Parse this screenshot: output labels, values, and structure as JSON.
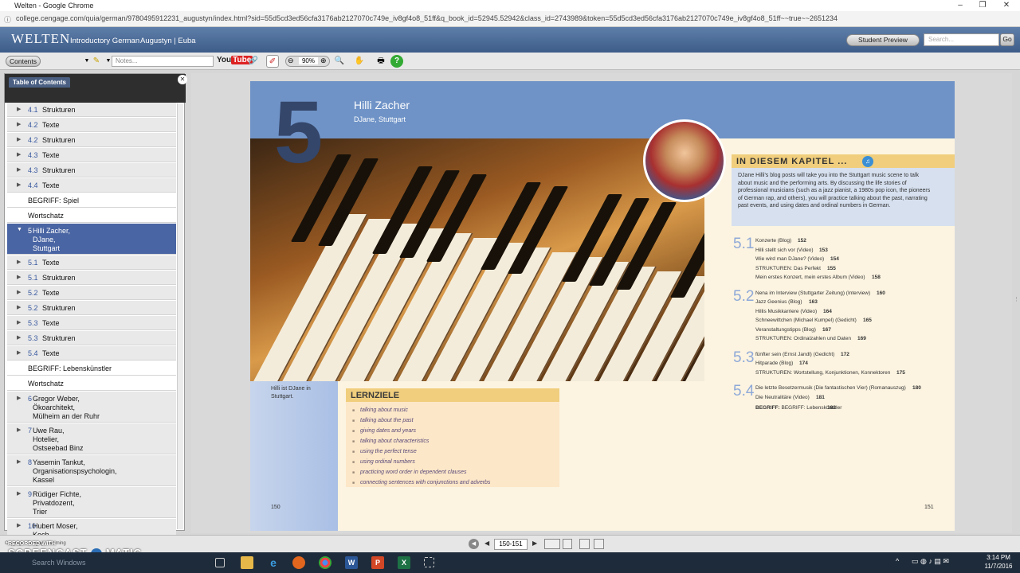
{
  "window": {
    "title": "Welten - Google Chrome"
  },
  "url": "college.cengage.com/quia/german/9780495912231_augustyn/index.html?sid=55d5cd3ed56cfa3176ab2127070c749e_iv8gf4o8_51ff&q_book_id=52945.52942&class_id=2743989&token=55d5cd3ed56cfa3176ab2127070c749e_iv8gf4o8_51ff~~true~~2651234",
  "header": {
    "logo": "WELTEN",
    "nav1": "Introductory German",
    "nav2": "Augustyn | Euba",
    "student_preview": "Student Preview",
    "search_placeholder": "Search...",
    "go": "Go"
  },
  "toolbar": {
    "contents": "Contents",
    "notes_placeholder": "Notes...",
    "zoom": "90%",
    "youtube": "YouTube"
  },
  "sidebar": {
    "title": "Table of Contents",
    "items": [
      {
        "num": "4.1",
        "label": "Strukturen",
        "style": "grey"
      },
      {
        "num": "4.2",
        "label": "Texte",
        "style": "grey"
      },
      {
        "num": "4.2",
        "label": "Strukturen",
        "style": "grey"
      },
      {
        "num": "4.3",
        "label": "Texte",
        "style": "grey"
      },
      {
        "num": "4.3",
        "label": "Strukturen",
        "style": "grey"
      },
      {
        "num": "4.4",
        "label": "Texte",
        "style": "grey"
      },
      {
        "num": "",
        "label": "BEGRIFF: Spiel",
        "style": "white"
      },
      {
        "num": "",
        "label": "Wortschatz",
        "style": "white"
      },
      {
        "num": "5",
        "label": "Hilli Zacher,\nDJane,\nStuttgart",
        "style": "sel"
      },
      {
        "num": "5.1",
        "label": "Texte",
        "style": "grey"
      },
      {
        "num": "5.1",
        "label": "Strukturen",
        "style": "grey"
      },
      {
        "num": "5.2",
        "label": "Texte",
        "style": "grey"
      },
      {
        "num": "5.2",
        "label": "Strukturen",
        "style": "grey"
      },
      {
        "num": "5.3",
        "label": "Texte",
        "style": "grey"
      },
      {
        "num": "5.3",
        "label": "Strukturen",
        "style": "grey"
      },
      {
        "num": "5.4",
        "label": "Texte",
        "style": "grey"
      },
      {
        "num": "",
        "label": "BEGRIFF: Lebenskünstler",
        "style": "white"
      },
      {
        "num": "",
        "label": "Wortschatz",
        "style": "white"
      },
      {
        "num": "6",
        "label": "Gregor Weber,\nÖkoarchitekt,\nMülheim an der Ruhr",
        "style": "grey"
      },
      {
        "num": "7",
        "label": "Uwe Rau,\nHotelier,\nOstseebad Binz",
        "style": "grey"
      },
      {
        "num": "8",
        "label": "Yasemin Tankut,\nOrganisationspsychologin,\nKassel",
        "style": "grey"
      },
      {
        "num": "9",
        "label": "Rüdiger Fichte,\nPrivatdozent,\nTrier",
        "style": "grey"
      },
      {
        "num": "10",
        "label": "Hubert Moser,\nKoch,",
        "style": "grey"
      }
    ]
  },
  "page": {
    "chapter_num": "5",
    "name": "Hilli Zacher",
    "subtitle": "DJane, Stuttgart",
    "caption": "Hilli ist DJane in Stuttgart.",
    "kapitel_title": "IN DIESEM KAPITEL ...",
    "kapitel_text": "DJane Hilli's blog posts will take you into the Stuttgart music scene to talk about music and the performing arts. By discussing the life stories of professional musicians (such as a jazz pianist, a 1980s pop icon, the pioneers of German rap, and others), you will practice talking about the past, narrating past events, and using dates and ordinal numbers in German.",
    "lernziele_title": "LERNZIELE",
    "lernziele": [
      "talking about music",
      "talking about the past",
      "giving dates and years",
      "talking about characteristics",
      "using the perfect tense",
      "using ordinal numbers",
      "practicing word order in dependent clauses",
      "connecting sentences with conjunctions and adverbs"
    ],
    "left_page_num": "150",
    "right_page_num": "151",
    "contents": [
      {
        "sec": "5.1",
        "lines": [
          {
            "t": "Konzerte (Blog)",
            "p": "152"
          },
          {
            "t": "Hilli stellt sich vor (Video)",
            "p": "153"
          },
          {
            "t": "Wie wird man DJane? (Video)",
            "p": "154"
          },
          {
            "t": "STRUKTUREN: Das Perfekt",
            "p": "155"
          },
          {
            "t": "Mein erstes Konzert, mein erstes Album (Video)",
            "p": "158"
          }
        ]
      },
      {
        "sec": "5.2",
        "lines": [
          {
            "t": "Nena im Interview (Stuttgarter Zeitung) (Interview)",
            "p": "160"
          },
          {
            "t": "Jazz Geenius (Blog)",
            "p": "163"
          },
          {
            "t": "Hillis Musikkarriere (Video)",
            "p": "164"
          },
          {
            "t": "Schneewittchen (Michael Kumpel) (Gedicht)",
            "p": "165"
          },
          {
            "t": "Veranstaltungstipps (Blog)",
            "p": "167"
          },
          {
            "t": "STRUKTUREN: Ordinalzahlen und Daten",
            "p": "169"
          }
        ]
      },
      {
        "sec": "5.3",
        "lines": [
          {
            "t": "fünfter sein (Ernst Jandl) (Gedicht)",
            "p": "172"
          },
          {
            "t": "Hitparade (Blog)",
            "p": "174"
          },
          {
            "t": "STRUKTUREN: Wortstellung, Konjunktionen, Konnektoren",
            "p": "175"
          }
        ]
      },
      {
        "sec": "5.4",
        "lines": [
          {
            "t": "Die letzte Besetzermusik (Die fantastischen Vier) (Romanauszug)",
            "p": "180"
          },
          {
            "t": "Die Neutralitäre (Video)",
            "p": "181"
          }
        ]
      }
    ],
    "begriff": {
      "t": "BEGRIFF: Lebenskünstler",
      "p": "183"
    }
  },
  "footer": {
    "page_range": "150-151",
    "copyright": "Copyright Cengage Learning"
  },
  "recorder": {
    "line1": "RECORDED WITH",
    "line2": "SCREENCAST",
    "line3": "MATIC"
  },
  "taskbar": {
    "search": "Search Windows",
    "time": "3:14 PM",
    "date": "11/7/2016"
  }
}
